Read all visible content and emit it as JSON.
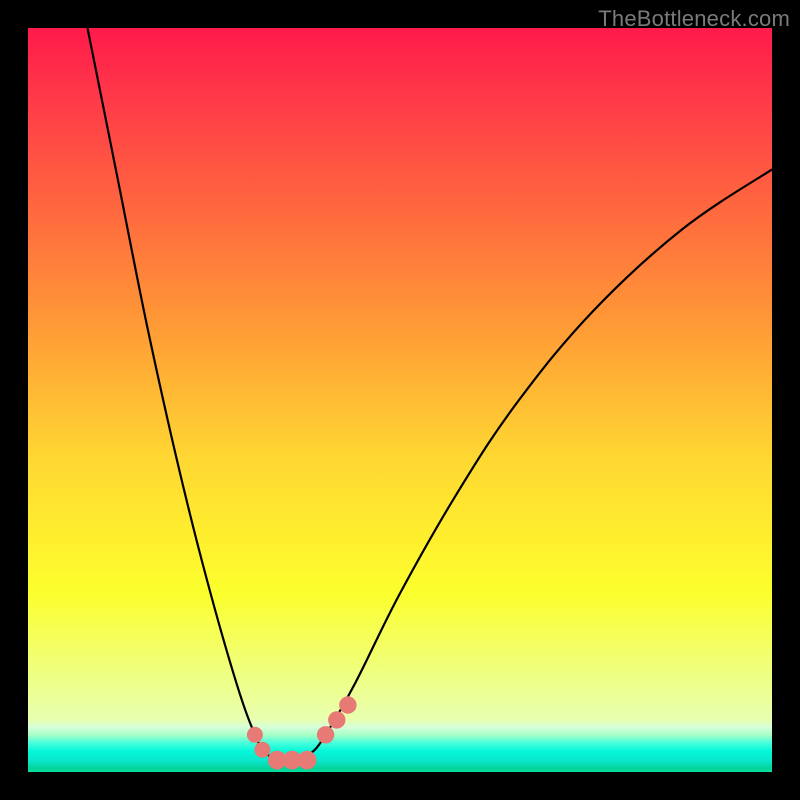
{
  "watermark": "TheBottleneck.com",
  "colors": {
    "curve_stroke": "#000000",
    "marker_fill": "#e77a74",
    "marker_stroke": "#b8534e"
  },
  "chart_data": {
    "type": "line",
    "title": "",
    "xlabel": "",
    "ylabel": "",
    "xlim": [
      0,
      100
    ],
    "ylim": [
      0,
      100
    ],
    "grid": false,
    "legend": false,
    "annotations": [],
    "series": [
      {
        "name": "bottleneck-curve",
        "x": [
          8,
          12,
          16,
          20,
          24,
          28,
          30.5,
          32,
          34,
          36,
          38,
          40,
          44,
          50,
          58,
          66,
          76,
          88,
          100
        ],
        "y": [
          100,
          80,
          60,
          42,
          26,
          12,
          5,
          2.5,
          1.6,
          1.6,
          2.5,
          5,
          12,
          24,
          38,
          50,
          62,
          73,
          81
        ]
      }
    ],
    "markers": [
      {
        "x": 30.5,
        "y": 5.0,
        "r": 1.2
      },
      {
        "x": 31.5,
        "y": 3.0,
        "r": 1.2
      },
      {
        "x": 33.5,
        "y": 1.6,
        "r": 1.4
      },
      {
        "x": 35.5,
        "y": 1.6,
        "r": 1.4
      },
      {
        "x": 37.5,
        "y": 1.6,
        "r": 1.4
      },
      {
        "x": 40.0,
        "y": 5.0,
        "r": 1.3
      },
      {
        "x": 41.5,
        "y": 7.0,
        "r": 1.3
      },
      {
        "x": 43.0,
        "y": 9.0,
        "r": 1.3
      }
    ]
  }
}
